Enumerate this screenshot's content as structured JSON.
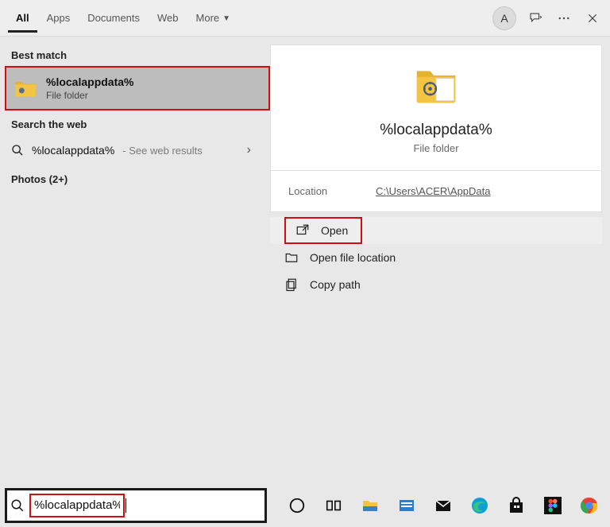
{
  "topbar": {
    "tabs": [
      "All",
      "Apps",
      "Documents",
      "Web",
      "More"
    ],
    "active_tab": "All",
    "avatar_initial": "A"
  },
  "left": {
    "best_match_label": "Best match",
    "best_match": {
      "title": "%localappdata%",
      "subtitle": "File folder"
    },
    "search_web_label": "Search the web",
    "web_result": {
      "query": "%localappdata%",
      "hint": "- See web results"
    },
    "photos_label": "Photos (2+)"
  },
  "preview": {
    "title": "%localappdata%",
    "subtitle": "File folder",
    "location_label": "Location",
    "location_value": "C:\\Users\\ACER\\AppData",
    "actions": {
      "open": "Open",
      "open_location": "Open file location",
      "copy_path": "Copy path"
    }
  },
  "search_input": {
    "value": "%localappdata%"
  }
}
